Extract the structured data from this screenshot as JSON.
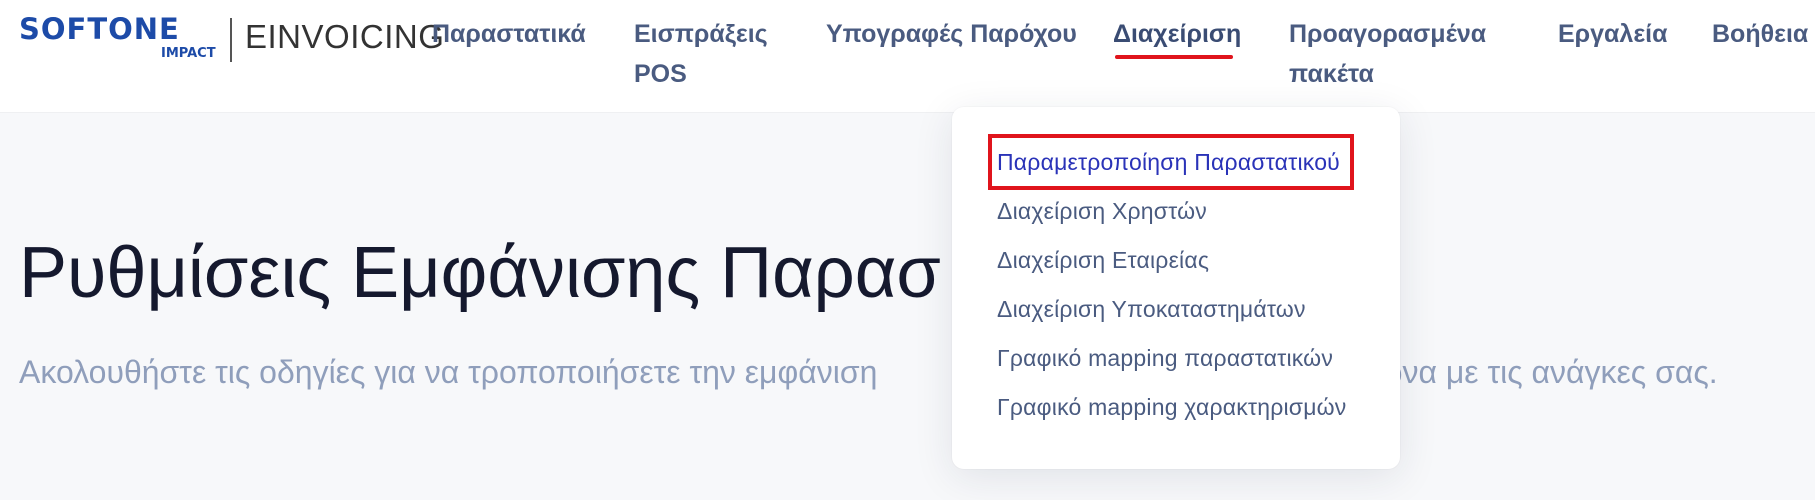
{
  "brand": {
    "name": "SOFTONE",
    "sub": "IMPACT",
    "product": "EINVOICING"
  },
  "nav": {
    "items": [
      {
        "label": "Παραστατικά"
      },
      {
        "label": "Εισπράξεις POS"
      },
      {
        "label": "Υπογραφές Παρόχου"
      },
      {
        "label": "Διαχείριση"
      },
      {
        "label": "Προαγορασμένα πακέτα"
      },
      {
        "label": "Εργαλεία"
      },
      {
        "label": "Βοήθεια"
      }
    ],
    "active": "Διαχείριση"
  },
  "dropdown": {
    "items": [
      {
        "label": "Παραμετροποίηση Παραστατικού"
      },
      {
        "label": "Διαχείριση Χρηστών"
      },
      {
        "label": "Διαχείριση Εταιρείας"
      },
      {
        "label": "Διαχείριση Υποκαταστημάτων"
      },
      {
        "label": "Γραφικό mapping παραστατικών"
      },
      {
        "label": "Γραφικό mapping χαρακτηρισμών"
      }
    ],
    "highlighted": "Παραμετροποίηση Παραστατικού"
  },
  "main": {
    "title": "Ρυθμίσεις Εμφάνισης Παρασ",
    "subtitle": "Ακολουθήστε τις οδηγίες για να τροποποιήσετε την εμφάνιση                                   ίας σας σύμφωνα με τις ανάγκες σας."
  },
  "colors": {
    "brand": "#1d4ba8",
    "accent": "#e0141c",
    "nav": "#4a5b80",
    "highlight_link": "#2a33b8"
  }
}
